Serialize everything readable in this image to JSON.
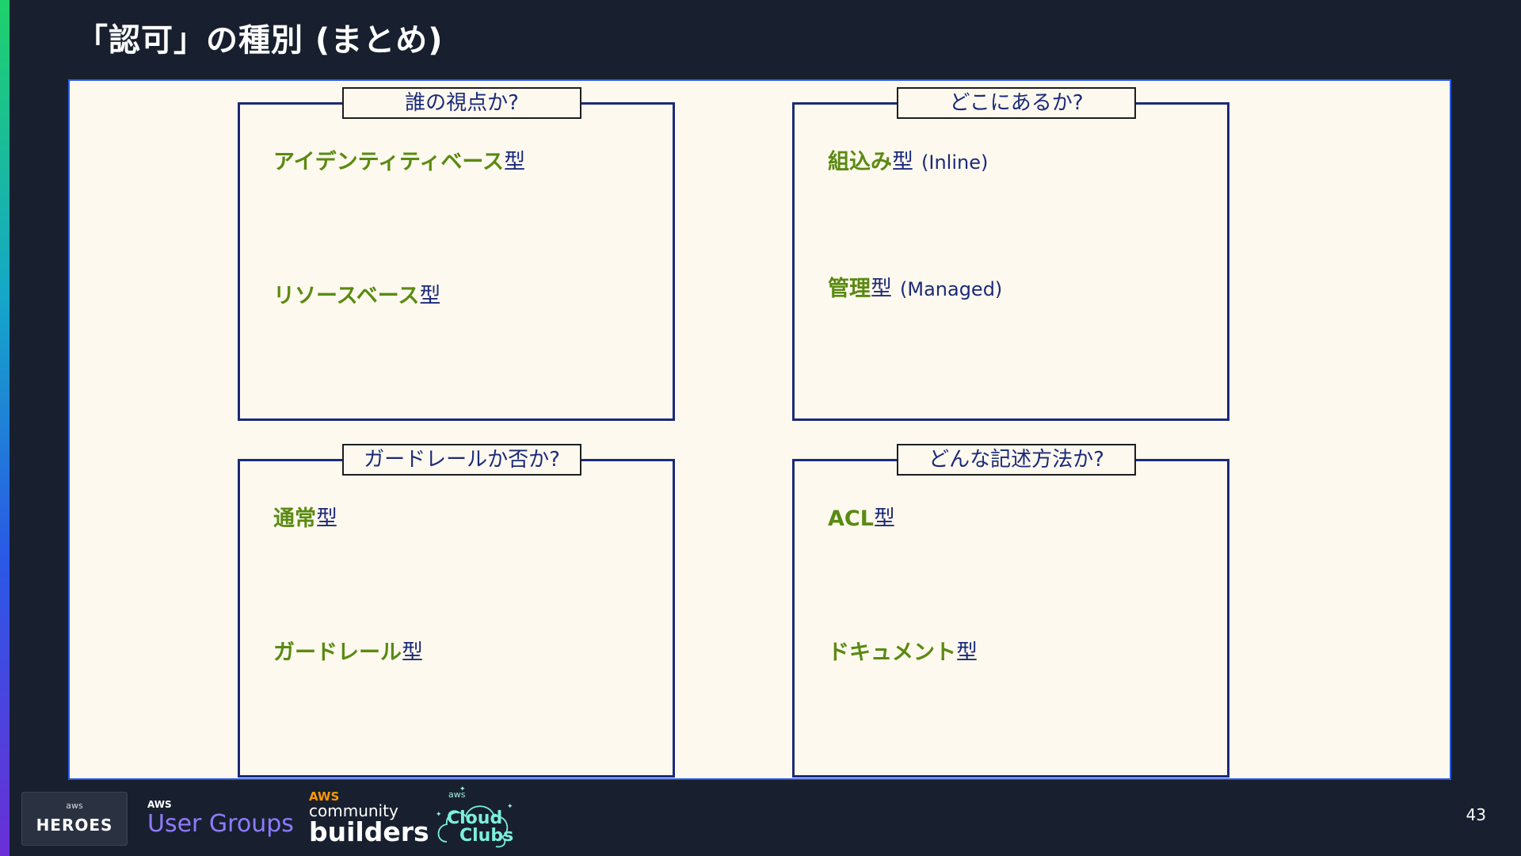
{
  "title": "「認可」の種別 (まとめ)",
  "boxes": [
    {
      "tag": "誰の視点か?",
      "items": [
        {
          "main": "アイデンティティベース",
          "suffix": "型",
          "note": ""
        },
        {
          "main": "リソースベース",
          "suffix": "型",
          "note": ""
        }
      ]
    },
    {
      "tag": "どこにあるか?",
      "items": [
        {
          "main": "組込み",
          "suffix": "型",
          "note": "(Inline)"
        },
        {
          "main": "管理",
          "suffix": "型",
          "note": "(Managed)"
        }
      ]
    },
    {
      "tag": "ガードレールか否か?",
      "items": [
        {
          "main": "通常",
          "suffix": "型",
          "note": ""
        },
        {
          "main": "ガードレール",
          "suffix": "型",
          "note": ""
        }
      ]
    },
    {
      "tag": "どんな記述方法か?",
      "items": [
        {
          "main": "ACL",
          "suffix": "型",
          "note": ""
        },
        {
          "main": "ドキュメント",
          "suffix": "型",
          "note": ""
        }
      ]
    }
  ],
  "footer": {
    "heroes_aws": "aws",
    "heroes": "HEROES",
    "ug_aws": "AWS",
    "user_groups": "User Groups",
    "cb_aws": "AWS",
    "community": "community",
    "builders": "builders",
    "cc_aws": "aws",
    "cloud": "Cloud",
    "clubs": "Clubs"
  },
  "page_number": "43",
  "colors": {
    "background": "#18202f",
    "panel": "#fdf9ee",
    "box_border": "#1b2a7a",
    "item_green": "#5a8a12"
  }
}
